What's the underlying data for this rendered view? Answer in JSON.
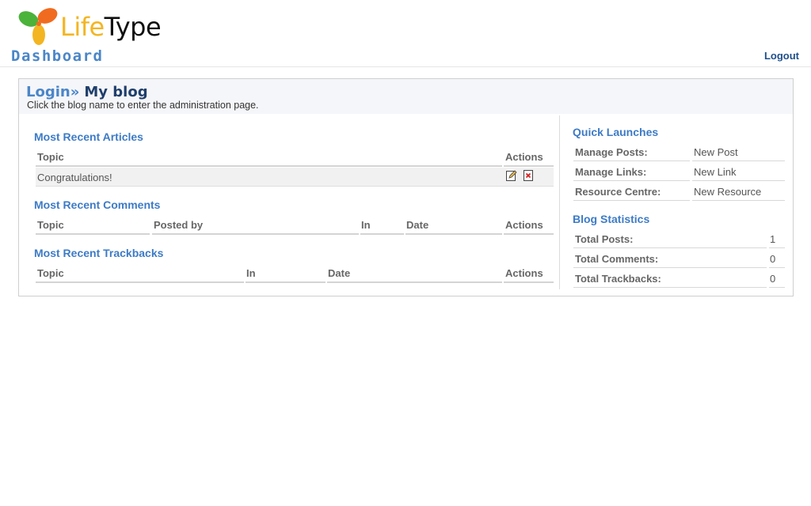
{
  "app": {
    "name_part1": "Life",
    "name_part2": "Type"
  },
  "header": {
    "title": "Dashboard",
    "logout": "Logout"
  },
  "crumb": {
    "login": "Login",
    "sep": "»",
    "blog": "My blog"
  },
  "subtitle": "Click the blog name to enter the administration page.",
  "articles": {
    "title": "Most Recent Articles",
    "headers": [
      "Topic",
      "Actions"
    ],
    "rows": [
      {
        "topic": "Congratulations!"
      }
    ]
  },
  "comments": {
    "title": "Most Recent Comments",
    "headers": [
      "Topic",
      "Posted by",
      "In",
      "Date",
      "Actions"
    ]
  },
  "trackbacks": {
    "title": "Most Recent Trackbacks",
    "headers": [
      "Topic",
      "In",
      "Date",
      "Actions"
    ]
  },
  "quick": {
    "title": "Quick Launches",
    "items": [
      {
        "label": "Manage Posts:",
        "link": "New Post"
      },
      {
        "label": "Manage Links:",
        "link": "New Link"
      },
      {
        "label": "Resource Centre:",
        "link": "New Resource"
      }
    ]
  },
  "stats": {
    "title": "Blog Statistics",
    "items": [
      {
        "label": "Total Posts:",
        "value": "1"
      },
      {
        "label": "Total Comments:",
        "value": "0"
      },
      {
        "label": "Total Trackbacks:",
        "value": "0"
      }
    ]
  },
  "colors": {
    "accent": "#3d7bc6",
    "dark": "#1f3f6c",
    "logo_yellow": "#f3b521",
    "logo_green": "#4bb23a",
    "logo_orange": "#f06b1f"
  },
  "icons": {
    "edit": "edit-icon",
    "delete": "delete-icon",
    "logo": "lifetype-logo-icon"
  }
}
